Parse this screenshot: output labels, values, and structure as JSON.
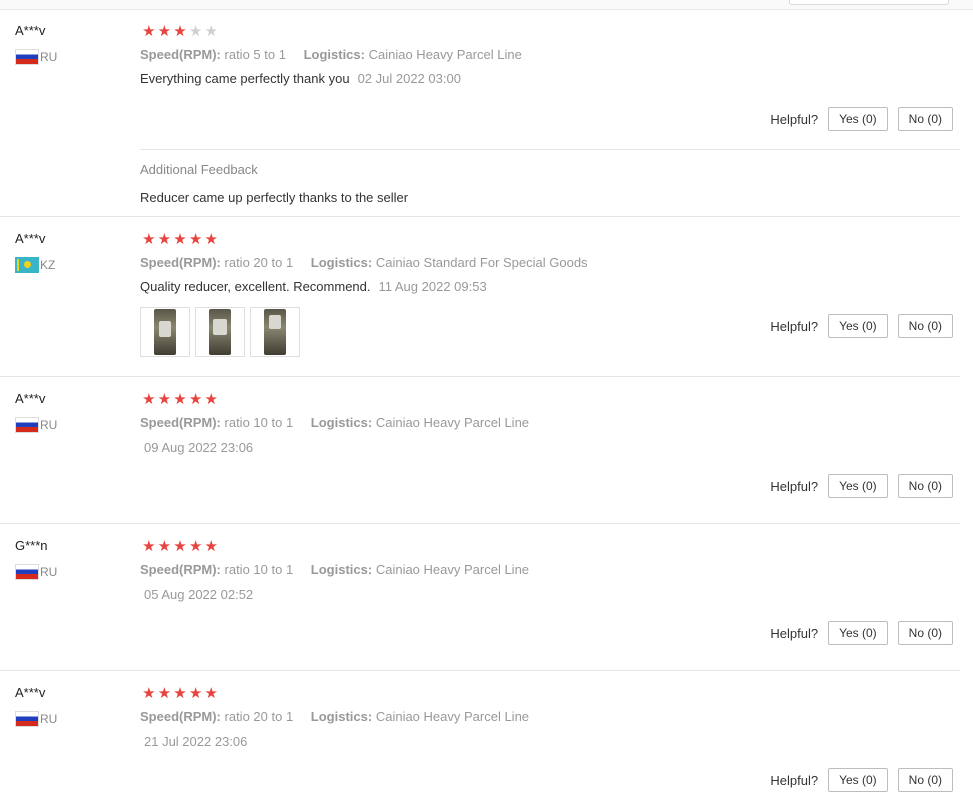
{
  "colors": {
    "star_on": "#e8443f",
    "star_off": "#d0d0d0",
    "muted": "#999999"
  },
  "reviews": [
    {
      "user": "A***v",
      "country": "RU",
      "flag": "ru-flag",
      "rating": 3,
      "speed_label": "Speed(RPM):",
      "speed_value": "ratio 5 to 1",
      "logistics_label": "Logistics:",
      "logistics_value": "Cainiao Heavy Parcel Line",
      "text": "Everything came perfectly thank you",
      "date": "02 Jul 2022 03:00",
      "helpful_label": "Helpful?",
      "yes": "Yes (0)",
      "no": "No (0)",
      "additional_title": "Additional Feedback",
      "additional_text": "Reducer came up perfectly thanks to the seller"
    },
    {
      "user": "A***v",
      "country": "KZ",
      "flag": "kz-flag",
      "rating": 5,
      "speed_label": "Speed(RPM):",
      "speed_value": "ratio 20 to 1",
      "logistics_label": "Logistics:",
      "logistics_value": "Cainiao Standard For Special Goods",
      "text": "Quality reducer, excellent. Recommend.",
      "date": "11 Aug 2022 09:53",
      "photos": [
        "reducer-photo",
        "reducer-photo",
        "reducer-photo"
      ],
      "helpful_label": "Helpful?",
      "yes": "Yes (0)",
      "no": "No (0)"
    },
    {
      "user": "A***v",
      "country": "RU",
      "flag": "ru-flag",
      "rating": 5,
      "speed_label": "Speed(RPM):",
      "speed_value": "ratio 10 to 1",
      "logistics_label": "Logistics:",
      "logistics_value": "Cainiao Heavy Parcel Line",
      "date": "09 Aug 2022 23:06",
      "helpful_label": "Helpful?",
      "yes": "Yes (0)",
      "no": "No (0)"
    },
    {
      "user": "G***n",
      "country": "RU",
      "flag": "ru-flag",
      "rating": 5,
      "speed_label": "Speed(RPM):",
      "speed_value": "ratio 10 to 1",
      "logistics_label": "Logistics:",
      "logistics_value": "Cainiao Heavy Parcel Line",
      "date": "05 Aug 2022 02:52",
      "helpful_label": "Helpful?",
      "yes": "Yes (0)",
      "no": "No (0)"
    },
    {
      "user": "A***v",
      "country": "RU",
      "flag": "ru-flag",
      "rating": 5,
      "speed_label": "Speed(RPM):",
      "speed_value": "ratio 20 to 1",
      "logistics_label": "Logistics:",
      "logistics_value": "Cainiao Heavy Parcel Line",
      "date": "21 Jul 2022 23:06",
      "helpful_label": "Helpful?",
      "yes": "Yes (0)",
      "no": "No (0)"
    }
  ]
}
